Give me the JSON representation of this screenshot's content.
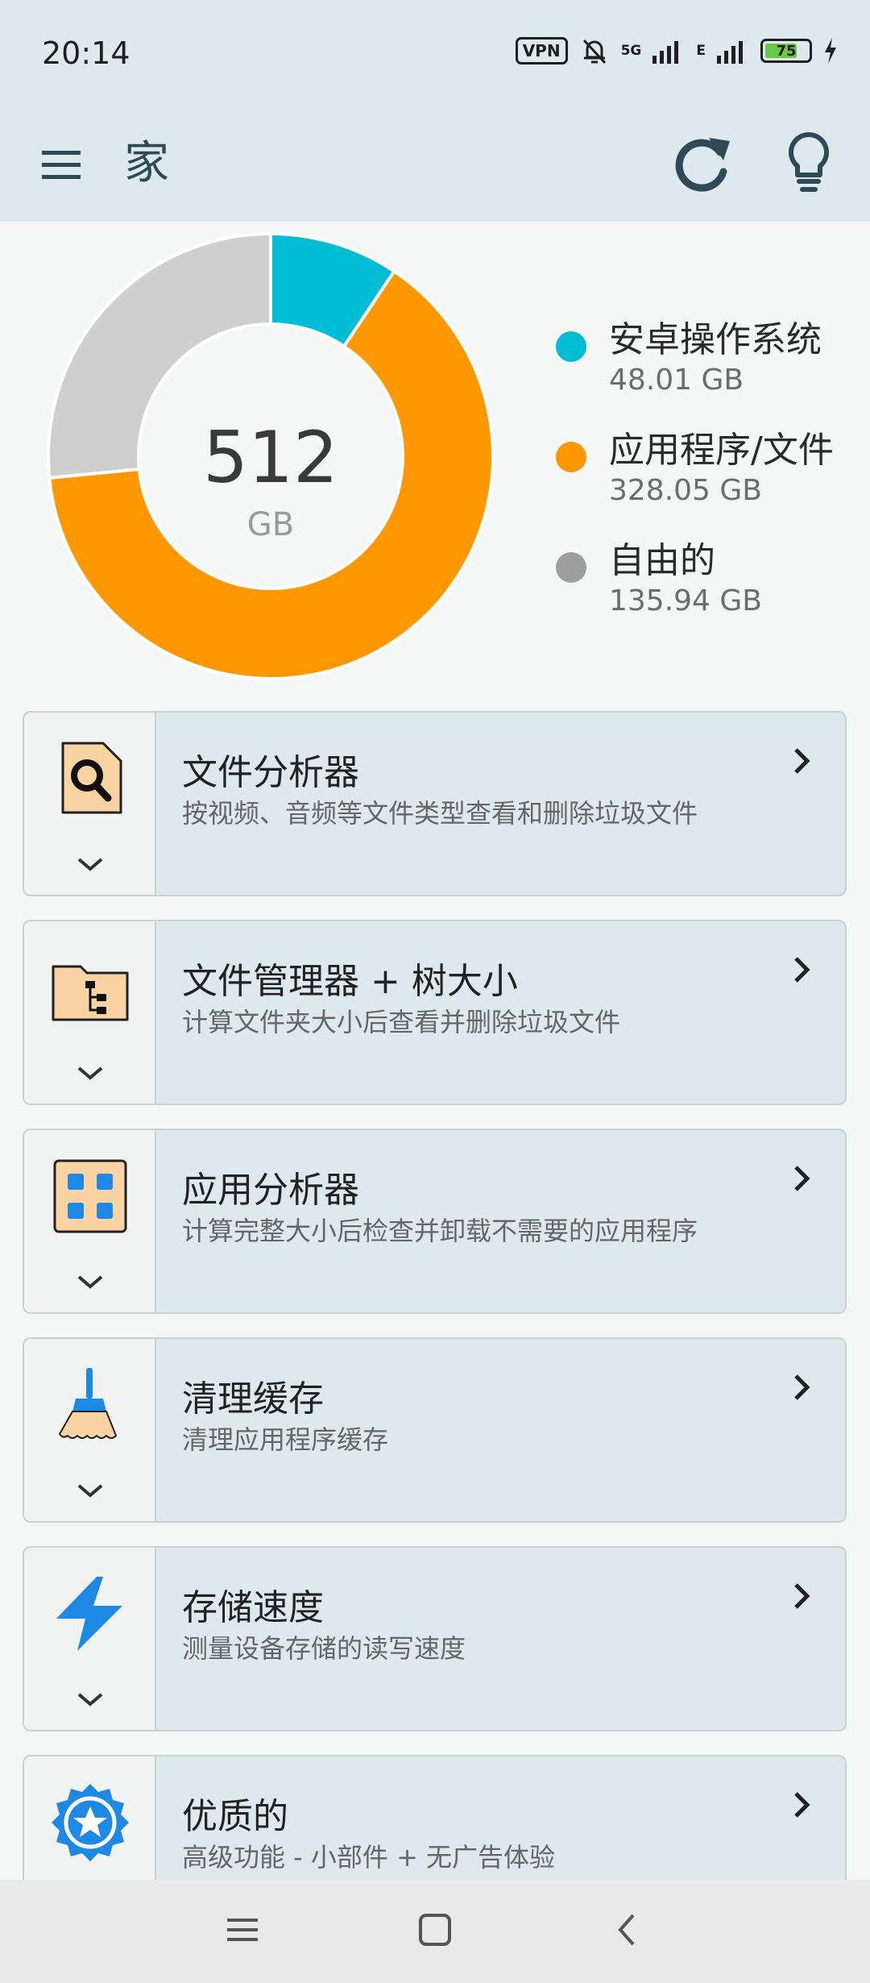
{
  "status_bar": {
    "time": "20:14",
    "vpn": "VPN",
    "network": "5G",
    "network2": "E",
    "battery": "75",
    "battery_level": 0.75
  },
  "app_bar": {
    "title": "家",
    "icons": [
      "menu-icon",
      "refresh-icon",
      "lightbulb-icon"
    ]
  },
  "storage": {
    "total_value": "512",
    "total_unit": "GB",
    "segments": [
      {
        "name": "安卓操作系统",
        "value": "48.01 GB",
        "amount": 48.01,
        "color": "#00bcd4"
      },
      {
        "name": "应用程序/文件",
        "value": "328.05 GB",
        "amount": 328.05,
        "color": "#ff9800"
      },
      {
        "name": "自由的",
        "value": "135.94 GB",
        "amount": 135.94,
        "color": "#cfcfcf"
      }
    ],
    "legend_colors": [
      "#00bcd4",
      "#ff9800",
      "#9e9e9e"
    ]
  },
  "cards": [
    {
      "title": "文件分析器",
      "subtitle": "按视频、音频等文件类型查看和删除垃圾文件",
      "icon": "file-search-icon"
    },
    {
      "title": "文件管理器 + 树大小",
      "subtitle": "计算文件夹大小后查看并删除垃圾文件",
      "icon": "folder-tree-icon"
    },
    {
      "title": "应用分析器",
      "subtitle": "计算完整大小后检查并卸载不需要的应用程序",
      "icon": "apps-grid-icon"
    },
    {
      "title": "清理缓存",
      "subtitle": "清理应用程序缓存",
      "icon": "broom-icon"
    },
    {
      "title": "存储速度",
      "subtitle": "测量设备存储的读写速度",
      "icon": "lightning-icon"
    },
    {
      "title": "优质的",
      "subtitle": "高级功能 - 小部件 + 无广告体验",
      "icon": "premium-star-icon"
    }
  ],
  "nav_bar": {
    "icons": [
      "recent-apps-icon",
      "home-icon",
      "back-icon"
    ]
  }
}
